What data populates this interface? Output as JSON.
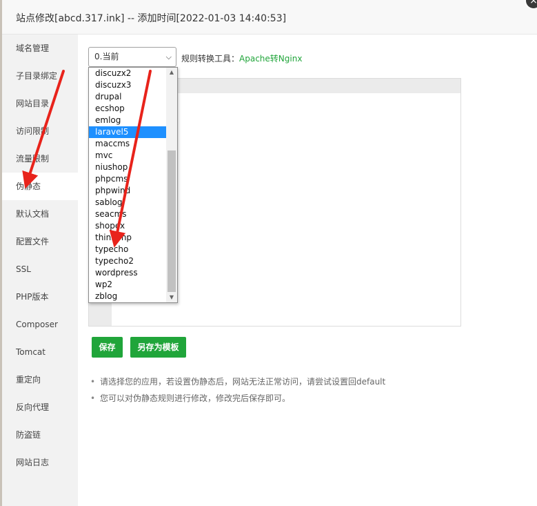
{
  "dialog": {
    "title": "站点修改[abcd.317.ink] -- 添加时间[2022-01-03 14:40:53]",
    "close_glyph": "×"
  },
  "sidebar": {
    "items": [
      {
        "label": "域名管理"
      },
      {
        "label": "子目录绑定"
      },
      {
        "label": "网站目录"
      },
      {
        "label": "访问限制"
      },
      {
        "label": "流量限制"
      },
      {
        "label": "伪静态",
        "active": true
      },
      {
        "label": "默认文档"
      },
      {
        "label": "配置文件"
      },
      {
        "label": "SSL"
      },
      {
        "label": "PHP版本"
      },
      {
        "label": "Composer"
      },
      {
        "label": "Tomcat"
      },
      {
        "label": "重定向"
      },
      {
        "label": "反向代理"
      },
      {
        "label": "防盗链"
      },
      {
        "label": "网站日志"
      }
    ]
  },
  "rewrite": {
    "select_value": "0.当前",
    "tool_label": "规则转换工具：",
    "tool_link": "Apache转Nginx",
    "dropdown_options": [
      "discuzx2",
      "discuzx3",
      "drupal",
      "ecshop",
      "emlog",
      "laravel5",
      "maccms",
      "mvc",
      "niushop",
      "phpcms",
      "phpwind",
      "sablog",
      "seacms",
      "shopex",
      "thinkphp",
      "typecho",
      "typecho2",
      "wordpress",
      "wp2",
      "zblog"
    ],
    "highlighted_option": "laravel5",
    "save_label": "保存",
    "save_template_label": "另存为模板",
    "tips": [
      "请选择您的应用，若设置伪静态后，网站无法正常访问，请尝试设置回default",
      "您可以对伪静态规则进行修改，修改完后保存即可。"
    ]
  },
  "colors": {
    "accent": "#20a53a",
    "highlight": "#1e90ff",
    "annotation_arrow": "#e8231b"
  },
  "icons": {
    "close": "close-icon",
    "select_arrow": "chevron-down-icon"
  }
}
